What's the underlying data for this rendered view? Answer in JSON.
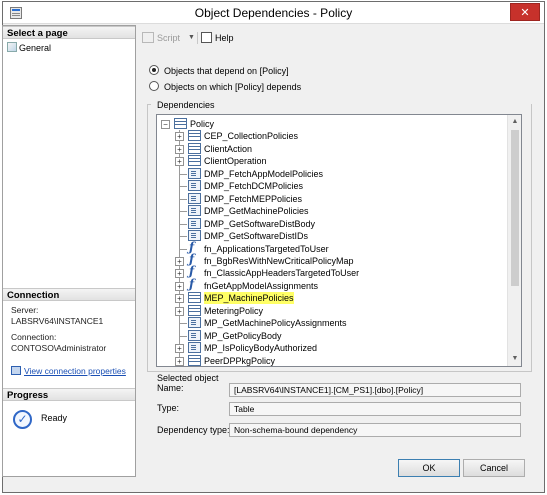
{
  "window": {
    "title": "Object Dependencies - Policy",
    "close_glyph": "✕"
  },
  "left": {
    "select_page_header": "Select a page",
    "general_label": "General",
    "connection_header": "Connection",
    "server_label": "Server:",
    "server_value": "LABSRV64\\INSTANCE1",
    "connection_label": "Connection:",
    "connection_value": "CONTOSO\\Administrator",
    "view_link": "View connection properties",
    "progress_header": "Progress",
    "ready_label": "Ready"
  },
  "toolbar": {
    "script_label": "Script",
    "script_arrow": "▼",
    "help_label": "Help"
  },
  "radios": [
    {
      "label": "Objects that depend on [Policy]",
      "selected": true
    },
    {
      "label": "Objects on which [Policy] depends",
      "selected": false
    }
  ],
  "dependencies": {
    "legend": "Dependencies",
    "root": "Policy",
    "items": [
      {
        "label": "CEP_CollectionPolicies",
        "icon": "table-icon",
        "expandable": true,
        "highlighted": false
      },
      {
        "label": "ClientAction",
        "icon": "table-icon",
        "expandable": true,
        "highlighted": false
      },
      {
        "label": "ClientOperation",
        "icon": "table-icon",
        "expandable": true,
        "highlighted": false
      },
      {
        "label": "DMP_FetchAppModelPolicies",
        "icon": "stored-procedure-icon",
        "expandable": false,
        "highlighted": false
      },
      {
        "label": "DMP_FetchDCMPolicies",
        "icon": "stored-procedure-icon",
        "expandable": false,
        "highlighted": false
      },
      {
        "label": "DMP_FetchMEPPolicies",
        "icon": "stored-procedure-icon",
        "expandable": false,
        "highlighted": false
      },
      {
        "label": "DMP_GetMachinePolicies",
        "icon": "stored-procedure-icon",
        "expandable": false,
        "highlighted": false
      },
      {
        "label": "DMP_GetSoftwareDistBody",
        "icon": "stored-procedure-icon",
        "expandable": false,
        "highlighted": false
      },
      {
        "label": "DMP_GetSoftwareDistIDs",
        "icon": "stored-procedure-icon",
        "expandable": false,
        "highlighted": false
      },
      {
        "label": "fn_ApplicationsTargetedToUser",
        "icon": "function-icon",
        "expandable": false,
        "highlighted": false
      },
      {
        "label": "fn_BgbResWithNewCriticalPolicyMap",
        "icon": "function-icon",
        "expandable": true,
        "highlighted": false
      },
      {
        "label": "fn_ClassicAppHeadersTargetedToUser",
        "icon": "function-icon",
        "expandable": true,
        "highlighted": false
      },
      {
        "label": "fnGetAppModelAssignments",
        "icon": "function-icon",
        "expandable": true,
        "highlighted": false
      },
      {
        "label": "MEP_MachinePolicies",
        "icon": "table-icon",
        "expandable": true,
        "highlighted": true
      },
      {
        "label": "MeteringPolicy",
        "icon": "table-icon",
        "expandable": true,
        "highlighted": false
      },
      {
        "label": "MP_GetMachinePolicyAssignments",
        "icon": "stored-procedure-icon",
        "expandable": false,
        "highlighted": false
      },
      {
        "label": "MP_GetPolicyBody",
        "icon": "stored-procedure-icon",
        "expandable": false,
        "highlighted": false
      },
      {
        "label": "MP_IsPolicyBodyAuthorized",
        "icon": "stored-procedure-icon",
        "expandable": true,
        "highlighted": false
      },
      {
        "label": "PeerDPPkgPolicy",
        "icon": "table-icon",
        "expandable": true,
        "highlighted": false
      }
    ]
  },
  "selected_object": {
    "header": "Selected object",
    "name_label": "Name:",
    "name_value": "[LABSRV64\\INSTANCE1].[CM_PS1].[dbo].[Policy]",
    "type_label": "Type:",
    "type_value": "Table",
    "dependency_type_label": "Dependency type:",
    "dependency_type_value": "Non-schema-bound dependency"
  },
  "buttons": {
    "ok": "OK",
    "cancel": "Cancel"
  }
}
